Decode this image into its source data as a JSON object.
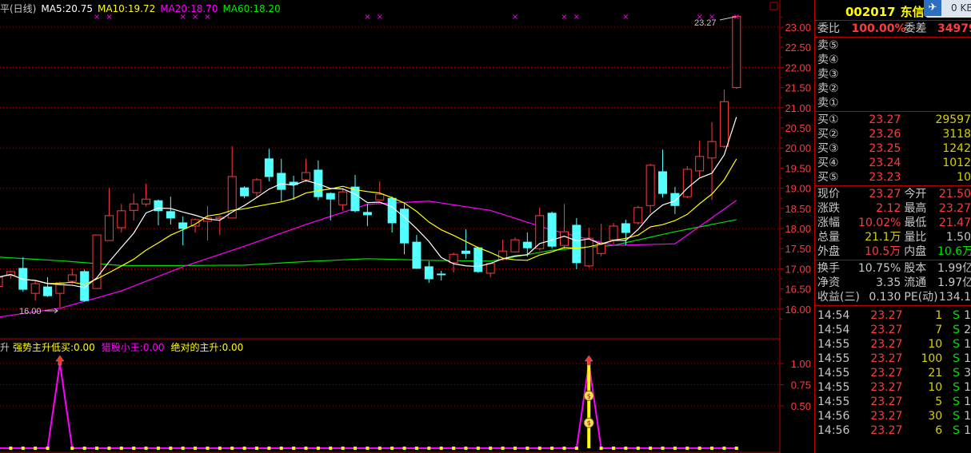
{
  "header": {
    "prefix": "平(日线)",
    "ma5": "MA5:20.75",
    "ma10": "MA10:19.72",
    "ma20": "MA20:18.70",
    "ma60": "MA60:18.20"
  },
  "indicator": {
    "prefix": "升",
    "s1": "强势主升低买:0.00",
    "s2": "猎股小王:0.00",
    "s3": "绝对的主升:0.00"
  },
  "colors": {
    "up": "#ff3b3b",
    "down": "#54ffff",
    "ma5": "#ffffff",
    "ma10": "#ffff00",
    "ma20": "#ff00ff",
    "ma60": "#00e000",
    "grid": "#b00000"
  },
  "annotations": {
    "low_label": "16.00",
    "high_label": "23.27"
  },
  "chart_data": {
    "type": "candlestick",
    "ylim": [
      15.6,
      23.4
    ],
    "yticks": [
      "23.00",
      "22.50",
      "22.00",
      "21.50",
      "21.00",
      "20.50",
      "20.00",
      "19.50",
      "19.00",
      "18.50",
      "18.00",
      "17.50",
      "17.00",
      "16.50",
      "16.00"
    ],
    "ohlc": [
      [
        16.56,
        16.82,
        16.5,
        16.79
      ],
      [
        16.83,
        16.95,
        16.75,
        16.93
      ],
      [
        17.01,
        17.29,
        16.43,
        16.49
      ],
      [
        16.39,
        16.7,
        16.21,
        16.63
      ],
      [
        16.55,
        16.79,
        16.3,
        16.33
      ],
      [
        16.39,
        16.68,
        16.04,
        16.65
      ],
      [
        16.69,
        17.0,
        16.62,
        16.85
      ],
      [
        16.93,
        16.98,
        16.18,
        16.21
      ],
      [
        16.51,
        17.84,
        16.51,
        17.84
      ],
      [
        17.7,
        19.01,
        17.7,
        18.32
      ],
      [
        18.02,
        18.61,
        17.9,
        18.44
      ],
      [
        18.45,
        18.87,
        18.2,
        18.61
      ],
      [
        18.61,
        19.11,
        18.55,
        18.73
      ],
      [
        18.69,
        18.72,
        18.08,
        18.44
      ],
      [
        18.42,
        18.79,
        18.1,
        18.26
      ],
      [
        18.14,
        18.3,
        17.58,
        18.0
      ],
      [
        18.06,
        18.25,
        17.9,
        18.22
      ],
      [
        18.18,
        18.56,
        17.7,
        18.26
      ],
      [
        18.25,
        18.32,
        17.84,
        18.28
      ],
      [
        18.26,
        20.04,
        18.26,
        19.29
      ],
      [
        19.01,
        19.05,
        18.75,
        18.81
      ],
      [
        18.89,
        19.25,
        18.77,
        19.21
      ],
      [
        19.73,
        19.98,
        19.17,
        19.29
      ],
      [
        19.37,
        19.73,
        18.67,
        18.97
      ],
      [
        19.15,
        19.31,
        18.71,
        19.09
      ],
      [
        19.21,
        19.73,
        19.15,
        19.39
      ],
      [
        19.45,
        19.69,
        18.7,
        18.79
      ],
      [
        18.87,
        18.9,
        18.2,
        18.73
      ],
      [
        18.59,
        19.0,
        18.44,
        18.91
      ],
      [
        19.03,
        19.33,
        18.4,
        18.44
      ],
      [
        18.4,
        18.61,
        18.06,
        18.34
      ],
      [
        18.71,
        19.17,
        18.7,
        18.85
      ],
      [
        18.75,
        18.8,
        17.9,
        18.14
      ],
      [
        18.48,
        18.61,
        17.36,
        17.64
      ],
      [
        17.66,
        17.84,
        17.0,
        17.01
      ],
      [
        17.05,
        17.19,
        16.65,
        16.75
      ],
      [
        16.87,
        16.95,
        16.71,
        16.86
      ],
      [
        17.15,
        17.4,
        16.91,
        17.36
      ],
      [
        17.44,
        17.98,
        17.25,
        17.38
      ],
      [
        17.52,
        17.55,
        16.9,
        16.93
      ],
      [
        16.89,
        17.15,
        16.79,
        17.13
      ],
      [
        17.23,
        17.72,
        17.2,
        17.44
      ],
      [
        17.42,
        17.78,
        17.4,
        17.72
      ],
      [
        17.66,
        17.9,
        17.3,
        17.52
      ],
      [
        17.5,
        18.52,
        17.45,
        18.32
      ],
      [
        18.38,
        18.42,
        17.5,
        17.56
      ],
      [
        17.58,
        18.61,
        17.5,
        17.92
      ],
      [
        18.08,
        18.26,
        16.99,
        17.15
      ],
      [
        17.07,
        18.02,
        17.03,
        17.76
      ],
      [
        17.38,
        18.12,
        17.31,
        17.64
      ],
      [
        17.72,
        18.14,
        17.6,
        18.06
      ],
      [
        18.12,
        18.22,
        17.58,
        17.9
      ],
      [
        18.14,
        18.56,
        18.1,
        18.52
      ],
      [
        18.57,
        19.61,
        18.38,
        19.57
      ],
      [
        19.41,
        19.96,
        18.77,
        18.87
      ],
      [
        18.87,
        19.03,
        18.36,
        18.57
      ],
      [
        18.79,
        19.55,
        18.75,
        19.47
      ],
      [
        19.43,
        20.18,
        19.27,
        19.79
      ],
      [
        19.75,
        20.64,
        18.71,
        20.16
      ],
      [
        20.04,
        21.45,
        20.0,
        21.15
      ],
      [
        21.5,
        23.27,
        21.47,
        23.27
      ]
    ],
    "ma20_every5": [
      15.8,
      16.02,
      16.45,
      17.05,
      17.56,
      18.1,
      18.6,
      18.68,
      18.45,
      17.96,
      17.58,
      17.62,
      18.7
    ],
    "ma60_every5": [
      17.29,
      17.2,
      17.08,
      17.08,
      17.09,
      17.18,
      17.25,
      17.21,
      17.19,
      17.46,
      17.58,
      17.92,
      18.22
    ],
    "signal_markers": [
      8,
      9,
      15,
      16,
      17,
      30,
      31,
      42,
      46,
      47,
      51,
      57,
      58,
      60
    ],
    "indicator": {
      "ylim": [
        0,
        1.1
      ],
      "yticks": [
        "1.00",
        "0.75",
        "0.50"
      ],
      "spikes": [
        5,
        48
      ],
      "spike_value": 1.0,
      "bar_index": 48
    }
  },
  "quote": {
    "code": "002017",
    "name": "东信和平",
    "kb": "0 KB",
    "weibi_label": "委比",
    "weibi": "100.00%",
    "weicha_label": "委差",
    "weicha": "34979",
    "sells": [
      {
        "label": "卖⑤"
      },
      {
        "label": "卖④"
      },
      {
        "label": "卖③"
      },
      {
        "label": "卖②"
      },
      {
        "label": "卖①"
      }
    ],
    "buys": [
      {
        "label": "买①",
        "price": "23.27",
        "vol": "29597"
      },
      {
        "label": "买②",
        "price": "23.26",
        "vol": "3118"
      },
      {
        "label": "买③",
        "price": "23.25",
        "vol": "1242"
      },
      {
        "label": "买④",
        "price": "23.24",
        "vol": "1012"
      },
      {
        "label": "买⑤",
        "price": "23.23",
        "vol": "10"
      }
    ],
    "stats": [
      {
        "l1": "现价",
        "v1": "23.27",
        "c1": "r",
        "l2": "今开",
        "v2": "21.50",
        "c2": "r"
      },
      {
        "l1": "涨跌",
        "v1": "2.12",
        "c1": "r",
        "l2": "最高",
        "v2": "23.27",
        "c2": "r"
      },
      {
        "l1": "涨幅",
        "v1": "10.02%",
        "c1": "r",
        "l2": "最低",
        "v2": "21.47",
        "c2": "r"
      },
      {
        "l1": "总量",
        "v1": "21.1万",
        "c1": "y",
        "l2": "量比",
        "v2": "1.50",
        "c2": "w"
      },
      {
        "l1": "外盘",
        "v1": "10.5万",
        "c1": "r",
        "l2": "内盘",
        "v2": "10.6万",
        "c2": "g"
      }
    ],
    "fin": [
      {
        "l1": "换手",
        "v1": "10.75%",
        "l2": "股本",
        "v2": "1.99亿"
      },
      {
        "l1": "净资",
        "v1": "3.35",
        "l2": "流通",
        "v2": "1.97亿"
      },
      {
        "l1": "收益(三)",
        "v1": "0.130",
        "l2": "PE(动)",
        "v2": "134.1"
      }
    ],
    "ticks": [
      {
        "t": "14:54",
        "p": "23.27",
        "v": "1",
        "s": "S",
        "n": "1"
      },
      {
        "t": "14:54",
        "p": "23.27",
        "v": "7",
        "s": "S",
        "n": "2"
      },
      {
        "t": "14:55",
        "p": "23.27",
        "v": "10",
        "s": "S",
        "n": "1"
      },
      {
        "t": "14:55",
        "p": "23.27",
        "v": "100",
        "s": "S",
        "n": "1"
      },
      {
        "t": "14:55",
        "p": "23.27",
        "v": "21",
        "s": "S",
        "n": "3"
      },
      {
        "t": "14:55",
        "p": "23.27",
        "v": "10",
        "s": "S",
        "n": "1"
      },
      {
        "t": "14:55",
        "p": "23.27",
        "v": "5",
        "s": "S",
        "n": "1"
      },
      {
        "t": "14:56",
        "p": "23.27",
        "v": "30",
        "s": "S",
        "n": "1"
      },
      {
        "t": "14:56",
        "p": "23.27",
        "v": "6",
        "s": "S",
        "n": "1"
      }
    ]
  }
}
